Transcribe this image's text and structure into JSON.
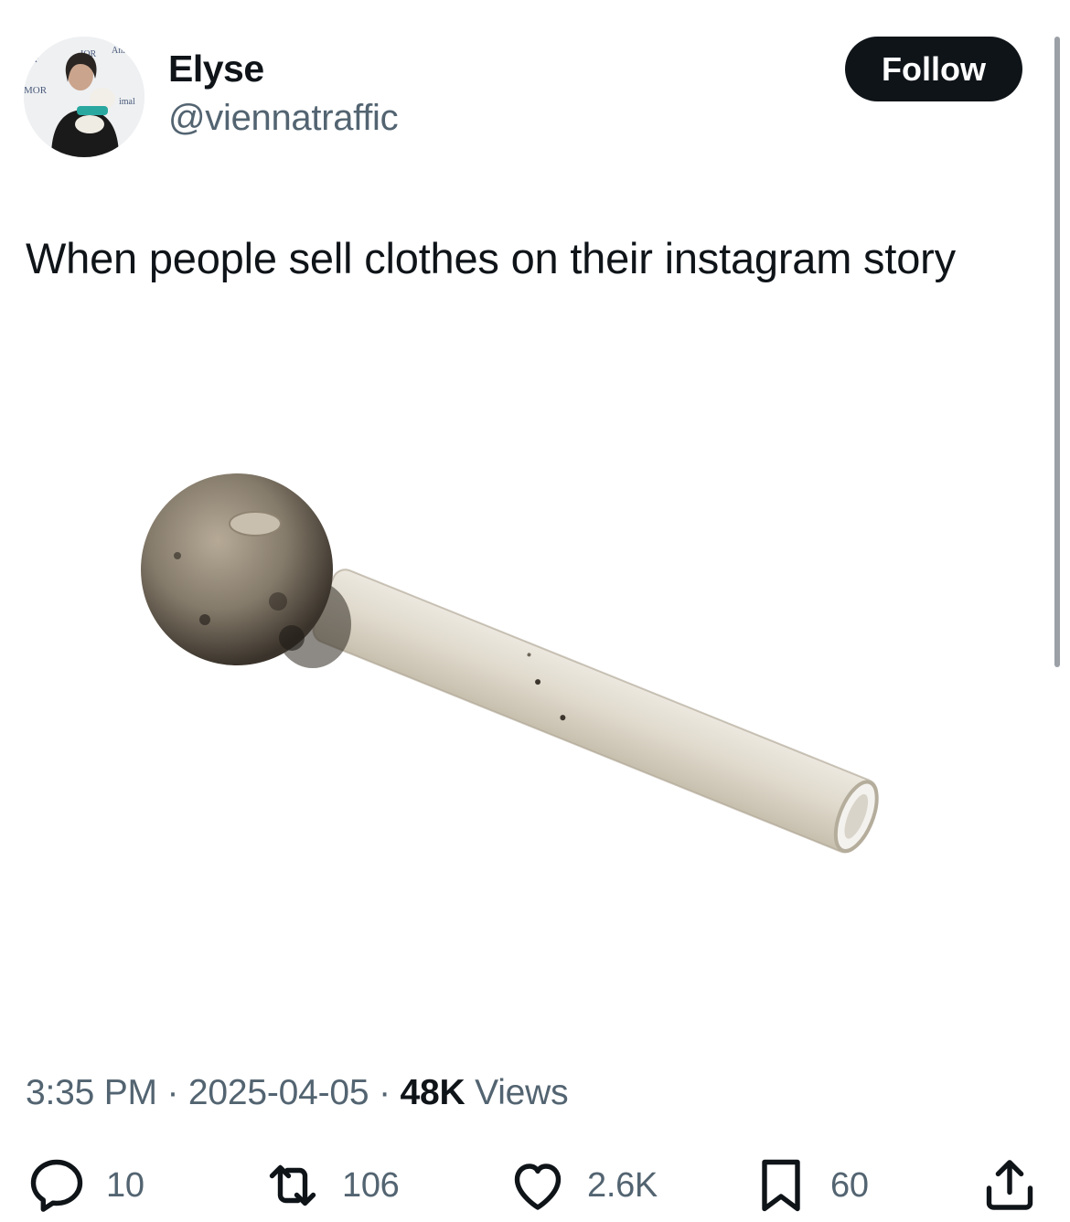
{
  "author": {
    "display_name": "Elyse",
    "handle": "@viennatraffic",
    "avatar_icon": "profile-photo"
  },
  "follow_label": "Follow",
  "tweet_text": "When people sell clothes on their instagram story",
  "media": {
    "description_icon": "glass-pipe-photo"
  },
  "meta": {
    "time": "3:35 PM",
    "separator": "·",
    "date": "2025-04-05",
    "views_count": "48K",
    "views_label": "Views"
  },
  "actions": {
    "replies": "10",
    "retweets": "106",
    "likes": "2.6K",
    "bookmarks": "60"
  },
  "colors": {
    "text_primary": "#0f1419",
    "text_secondary": "#536471",
    "button_bg": "#0f1419"
  }
}
